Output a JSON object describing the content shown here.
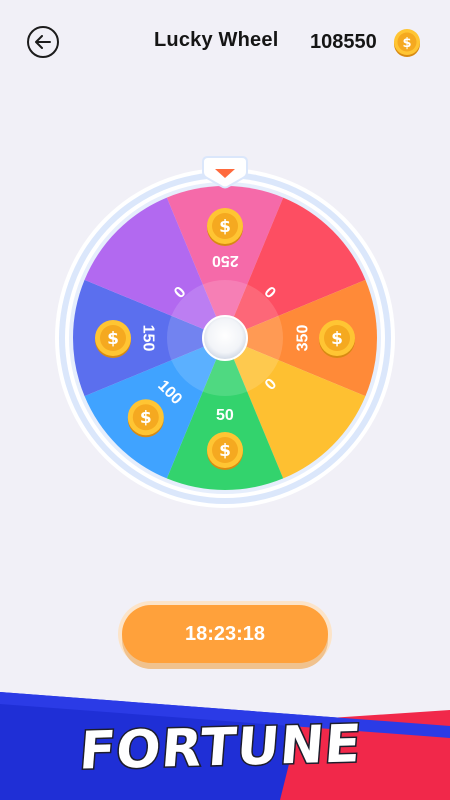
{
  "header": {
    "title": "Lucky Wheel",
    "balance": "108550",
    "back_icon": "back-arrow-icon",
    "coin_icon": "coin-icon"
  },
  "wheel": {
    "segments": [
      {
        "label": "250",
        "color": "#f56aa9",
        "has_coin": true
      },
      {
        "label": "0",
        "color": "#fd4e62",
        "has_coin": false
      },
      {
        "label": "350",
        "color": "#ff8a38",
        "has_coin": true
      },
      {
        "label": "0",
        "color": "#fec031",
        "has_coin": false
      },
      {
        "label": "50",
        "color": "#33d36d",
        "has_coin": true
      },
      {
        "label": "100",
        "color": "#40a3ff",
        "has_coin": true
      },
      {
        "label": "150",
        "color": "#5b6fee",
        "has_coin": true
      },
      {
        "label": "0",
        "color": "#b269f0",
        "has_coin": false
      }
    ]
  },
  "timer": {
    "label": "18:23:18"
  },
  "banner": {
    "text": "FORTUNE"
  },
  "colors": {
    "accent": "#ffa13b",
    "background": "#f1f0f7",
    "rim": "#d7e5fb"
  }
}
